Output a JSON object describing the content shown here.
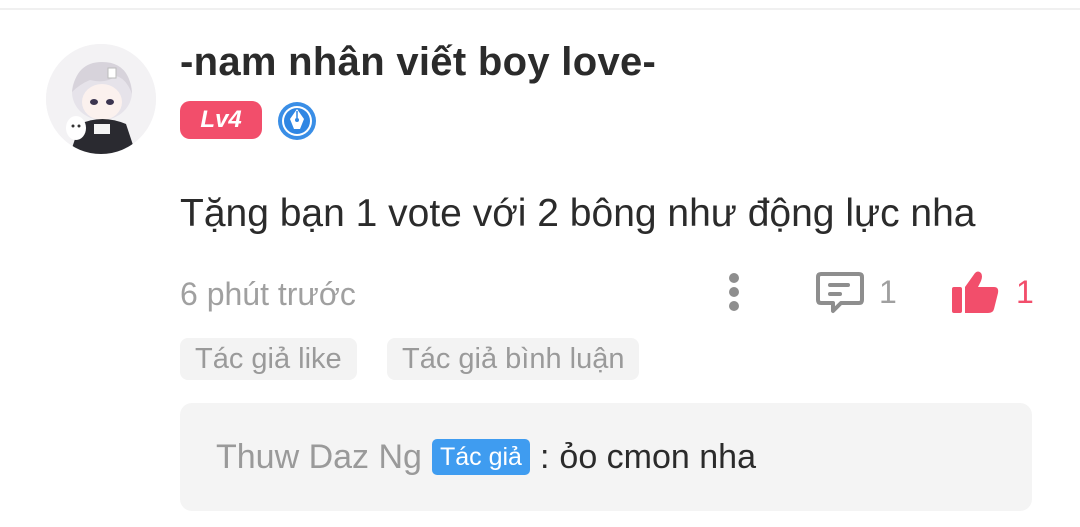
{
  "comment": {
    "username": "-nam nhân viết boy love-",
    "level": "Lv4",
    "text": "Tặng bạn 1 vote với 2 bông như động lực nha",
    "timestamp": "6 phút trước",
    "reply_count": "1",
    "like_count": "1",
    "tags": [
      "Tác giả like",
      "Tác giả bình luận"
    ]
  },
  "reply": {
    "author": "Thuw Daz Ng",
    "badge": "Tác giả",
    "separator": ":",
    "text": "ỏo cmon nha"
  },
  "icons": {
    "avatar": "anime-avatar",
    "writer_badge": "pen-nib-icon",
    "more": "more-vertical-icon",
    "reply": "comment-icon",
    "like": "thumbs-up-icon"
  },
  "colors": {
    "accent": "#f24e6b",
    "author_badge": "#3f9cf0",
    "muted_text": "#a0a0a0",
    "primary_text": "#2b2b2b"
  }
}
